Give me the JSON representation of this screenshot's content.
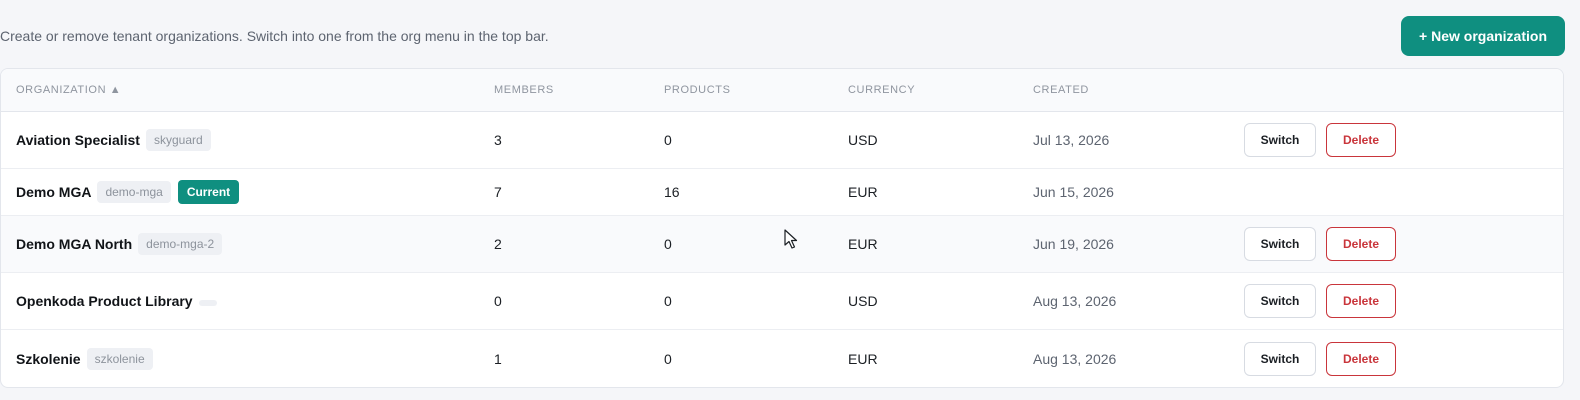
{
  "header": {
    "subtitle": "Create or remove tenant organizations. Switch into one from the org menu in the top bar.",
    "new_button_label": "+ New organization"
  },
  "table": {
    "columns": {
      "organization": "ORGANIZATION ▲",
      "members": "MEMBERS",
      "products": "PRODUCTS",
      "currency": "CURRENCY",
      "created": "CREATED"
    },
    "rows": [
      {
        "name": "Aviation Specialist",
        "slug": "skyguard",
        "members": "3",
        "products": "0",
        "currency": "USD",
        "created": "Jul 13, 2026",
        "switch": "Switch",
        "delete": "Delete"
      },
      {
        "name": "Demo MGA",
        "slug": "demo-mga",
        "current": "Current",
        "members": "7",
        "products": "16",
        "currency": "EUR",
        "created": "Jun 15, 2026"
      },
      {
        "name": "Demo MGA North",
        "slug": "demo-mga-2",
        "members": "2",
        "products": "0",
        "currency": "EUR",
        "created": "Jun 19, 2026",
        "switch": "Switch",
        "delete": "Delete"
      },
      {
        "name": "Openkoda Product Library",
        "slug": "",
        "members": "0",
        "products": "0",
        "currency": "USD",
        "created": "Aug 13, 2026",
        "switch": "Switch",
        "delete": "Delete"
      },
      {
        "name": "Szkolenie",
        "slug": "szkolenie",
        "members": "1",
        "products": "0",
        "currency": "EUR",
        "created": "Aug 13, 2026",
        "switch": "Switch",
        "delete": "Delete"
      }
    ]
  },
  "colors": {
    "accent": "#0f8f80",
    "danger": "#c9353b"
  }
}
